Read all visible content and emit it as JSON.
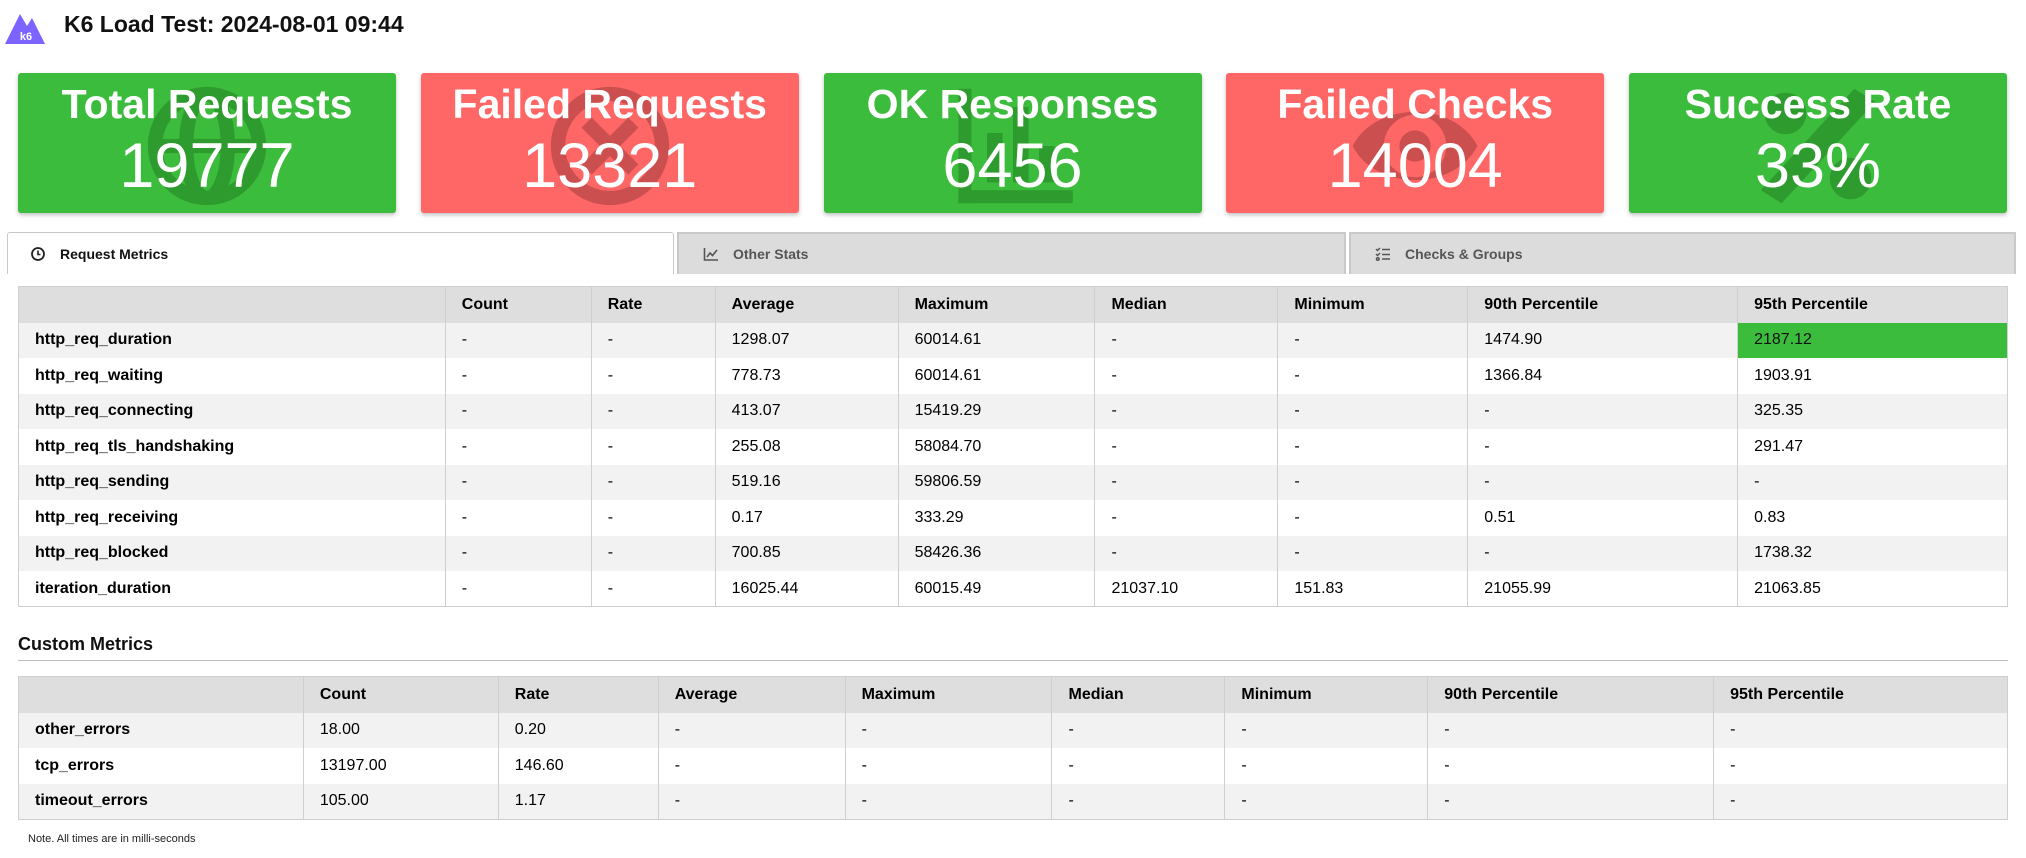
{
  "header": {
    "logo_text": "k6",
    "title": "K6 Load Test: 2024-08-01 09:44"
  },
  "colors": {
    "green": "#3cbc3c",
    "red": "#ff6666",
    "logo": "#7d64ff"
  },
  "cards": [
    {
      "label": "Total Requests",
      "value": "19777",
      "color": "green",
      "icon": "globe-icon"
    },
    {
      "label": "Failed Requests",
      "value": "13321",
      "color": "red",
      "icon": "times-circle-icon"
    },
    {
      "label": "OK Responses",
      "value": "6456",
      "color": "green",
      "icon": "chart-icon"
    },
    {
      "label": "Failed Checks",
      "value": "14004",
      "color": "red",
      "icon": "eye-icon"
    },
    {
      "label": "Success Rate",
      "value": "33%",
      "color": "green",
      "icon": "percent-icon"
    }
  ],
  "tabs": [
    {
      "label": "Request Metrics",
      "icon": "clock-icon",
      "active": true
    },
    {
      "label": "Other Stats",
      "icon": "chart-line-icon",
      "active": false
    },
    {
      "label": "Checks & Groups",
      "icon": "tasks-icon",
      "active": false
    }
  ],
  "request_table": {
    "headers": [
      "",
      "Count",
      "Rate",
      "Average",
      "Maximum",
      "Median",
      "Minimum",
      "90th Percentile",
      "95th Percentile"
    ],
    "rows": [
      [
        "http_req_duration",
        "-",
        "-",
        "1298.07",
        "60014.61",
        "-",
        "-",
        "1474.90",
        "2187.12"
      ],
      [
        "http_req_waiting",
        "-",
        "-",
        "778.73",
        "60014.61",
        "-",
        "-",
        "1366.84",
        "1903.91"
      ],
      [
        "http_req_connecting",
        "-",
        "-",
        "413.07",
        "15419.29",
        "-",
        "-",
        "-",
        "325.35"
      ],
      [
        "http_req_tls_handshaking",
        "-",
        "-",
        "255.08",
        "58084.70",
        "-",
        "-",
        "-",
        "291.47"
      ],
      [
        "http_req_sending",
        "-",
        "-",
        "519.16",
        "59806.59",
        "-",
        "-",
        "-",
        "-"
      ],
      [
        "http_req_receiving",
        "-",
        "-",
        "0.17",
        "333.29",
        "-",
        "-",
        "0.51",
        "0.83"
      ],
      [
        "http_req_blocked",
        "-",
        "-",
        "700.85",
        "58426.36",
        "-",
        "-",
        "-",
        "1738.32"
      ],
      [
        "iteration_duration",
        "-",
        "-",
        "16025.44",
        "60015.49",
        "21037.10",
        "151.83",
        "21055.99",
        "21063.85"
      ]
    ]
  },
  "custom_section": {
    "title": "Custom Metrics"
  },
  "custom_table": {
    "headers": [
      "",
      "Count",
      "Rate",
      "Average",
      "Maximum",
      "Median",
      "Minimum",
      "90th Percentile",
      "95th Percentile"
    ],
    "rows": [
      [
        "other_errors",
        "18.00",
        "0.20",
        "-",
        "-",
        "-",
        "-",
        "-",
        "-"
      ],
      [
        "tcp_errors",
        "13197.00",
        "146.60",
        "-",
        "-",
        "-",
        "-",
        "-",
        "-"
      ],
      [
        "timeout_errors",
        "105.00",
        "1.17",
        "-",
        "-",
        "-",
        "-",
        "-",
        "-"
      ]
    ]
  },
  "note": "Note. All times are in milli-seconds"
}
